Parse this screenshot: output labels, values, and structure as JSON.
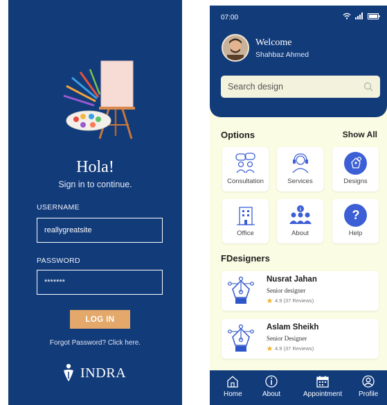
{
  "login": {
    "greeting": "Hola!",
    "subtitle": "Sign in to continue.",
    "username_label": "USERNAME",
    "username_value": "reallygreatsite",
    "password_label": "PASSWORD",
    "password_value": "*******",
    "login_button": "LOG IN",
    "forgot_text": "Forgot Password? Click here.",
    "brand": "INDRA"
  },
  "app": {
    "status": {
      "time": "07:00"
    },
    "header": {
      "welcome": "Welcome",
      "user_name": "Shahbaz Ahmed"
    },
    "search": {
      "placeholder": "Search design"
    },
    "options": {
      "title": "Options",
      "show_all": "Show All",
      "items": [
        {
          "label": "Consultation",
          "icon": "consultation-icon"
        },
        {
          "label": "Services",
          "icon": "headset-icon"
        },
        {
          "label": "Designs",
          "icon": "pen-tool-icon"
        },
        {
          "label": "Office",
          "icon": "office-building-icon"
        },
        {
          "label": "About",
          "icon": "team-info-icon"
        },
        {
          "label": "Help",
          "icon": "question-icon"
        }
      ]
    },
    "designers": {
      "title": "FDesigners",
      "items": [
        {
          "name": "Nusrat Jahan",
          "role": "Senior designer",
          "rating": "4.9 (37 Reviews)"
        },
        {
          "name": "Aslam Sheikh",
          "role": "Senior Designer",
          "rating": "4.9 (37 Reviews)"
        }
      ]
    },
    "nav": [
      {
        "label": "Home",
        "icon": "home-icon"
      },
      {
        "label": "About",
        "icon": "info-icon"
      },
      {
        "label": "Appointment",
        "icon": "calendar-icon"
      },
      {
        "label": "Profile",
        "icon": "profile-icon"
      }
    ]
  },
  "colors": {
    "navy": "#123b7a",
    "gold_button": "#e3a86a",
    "cream_background": "#fbfce4",
    "accent_blue": "#3c5fd6"
  }
}
